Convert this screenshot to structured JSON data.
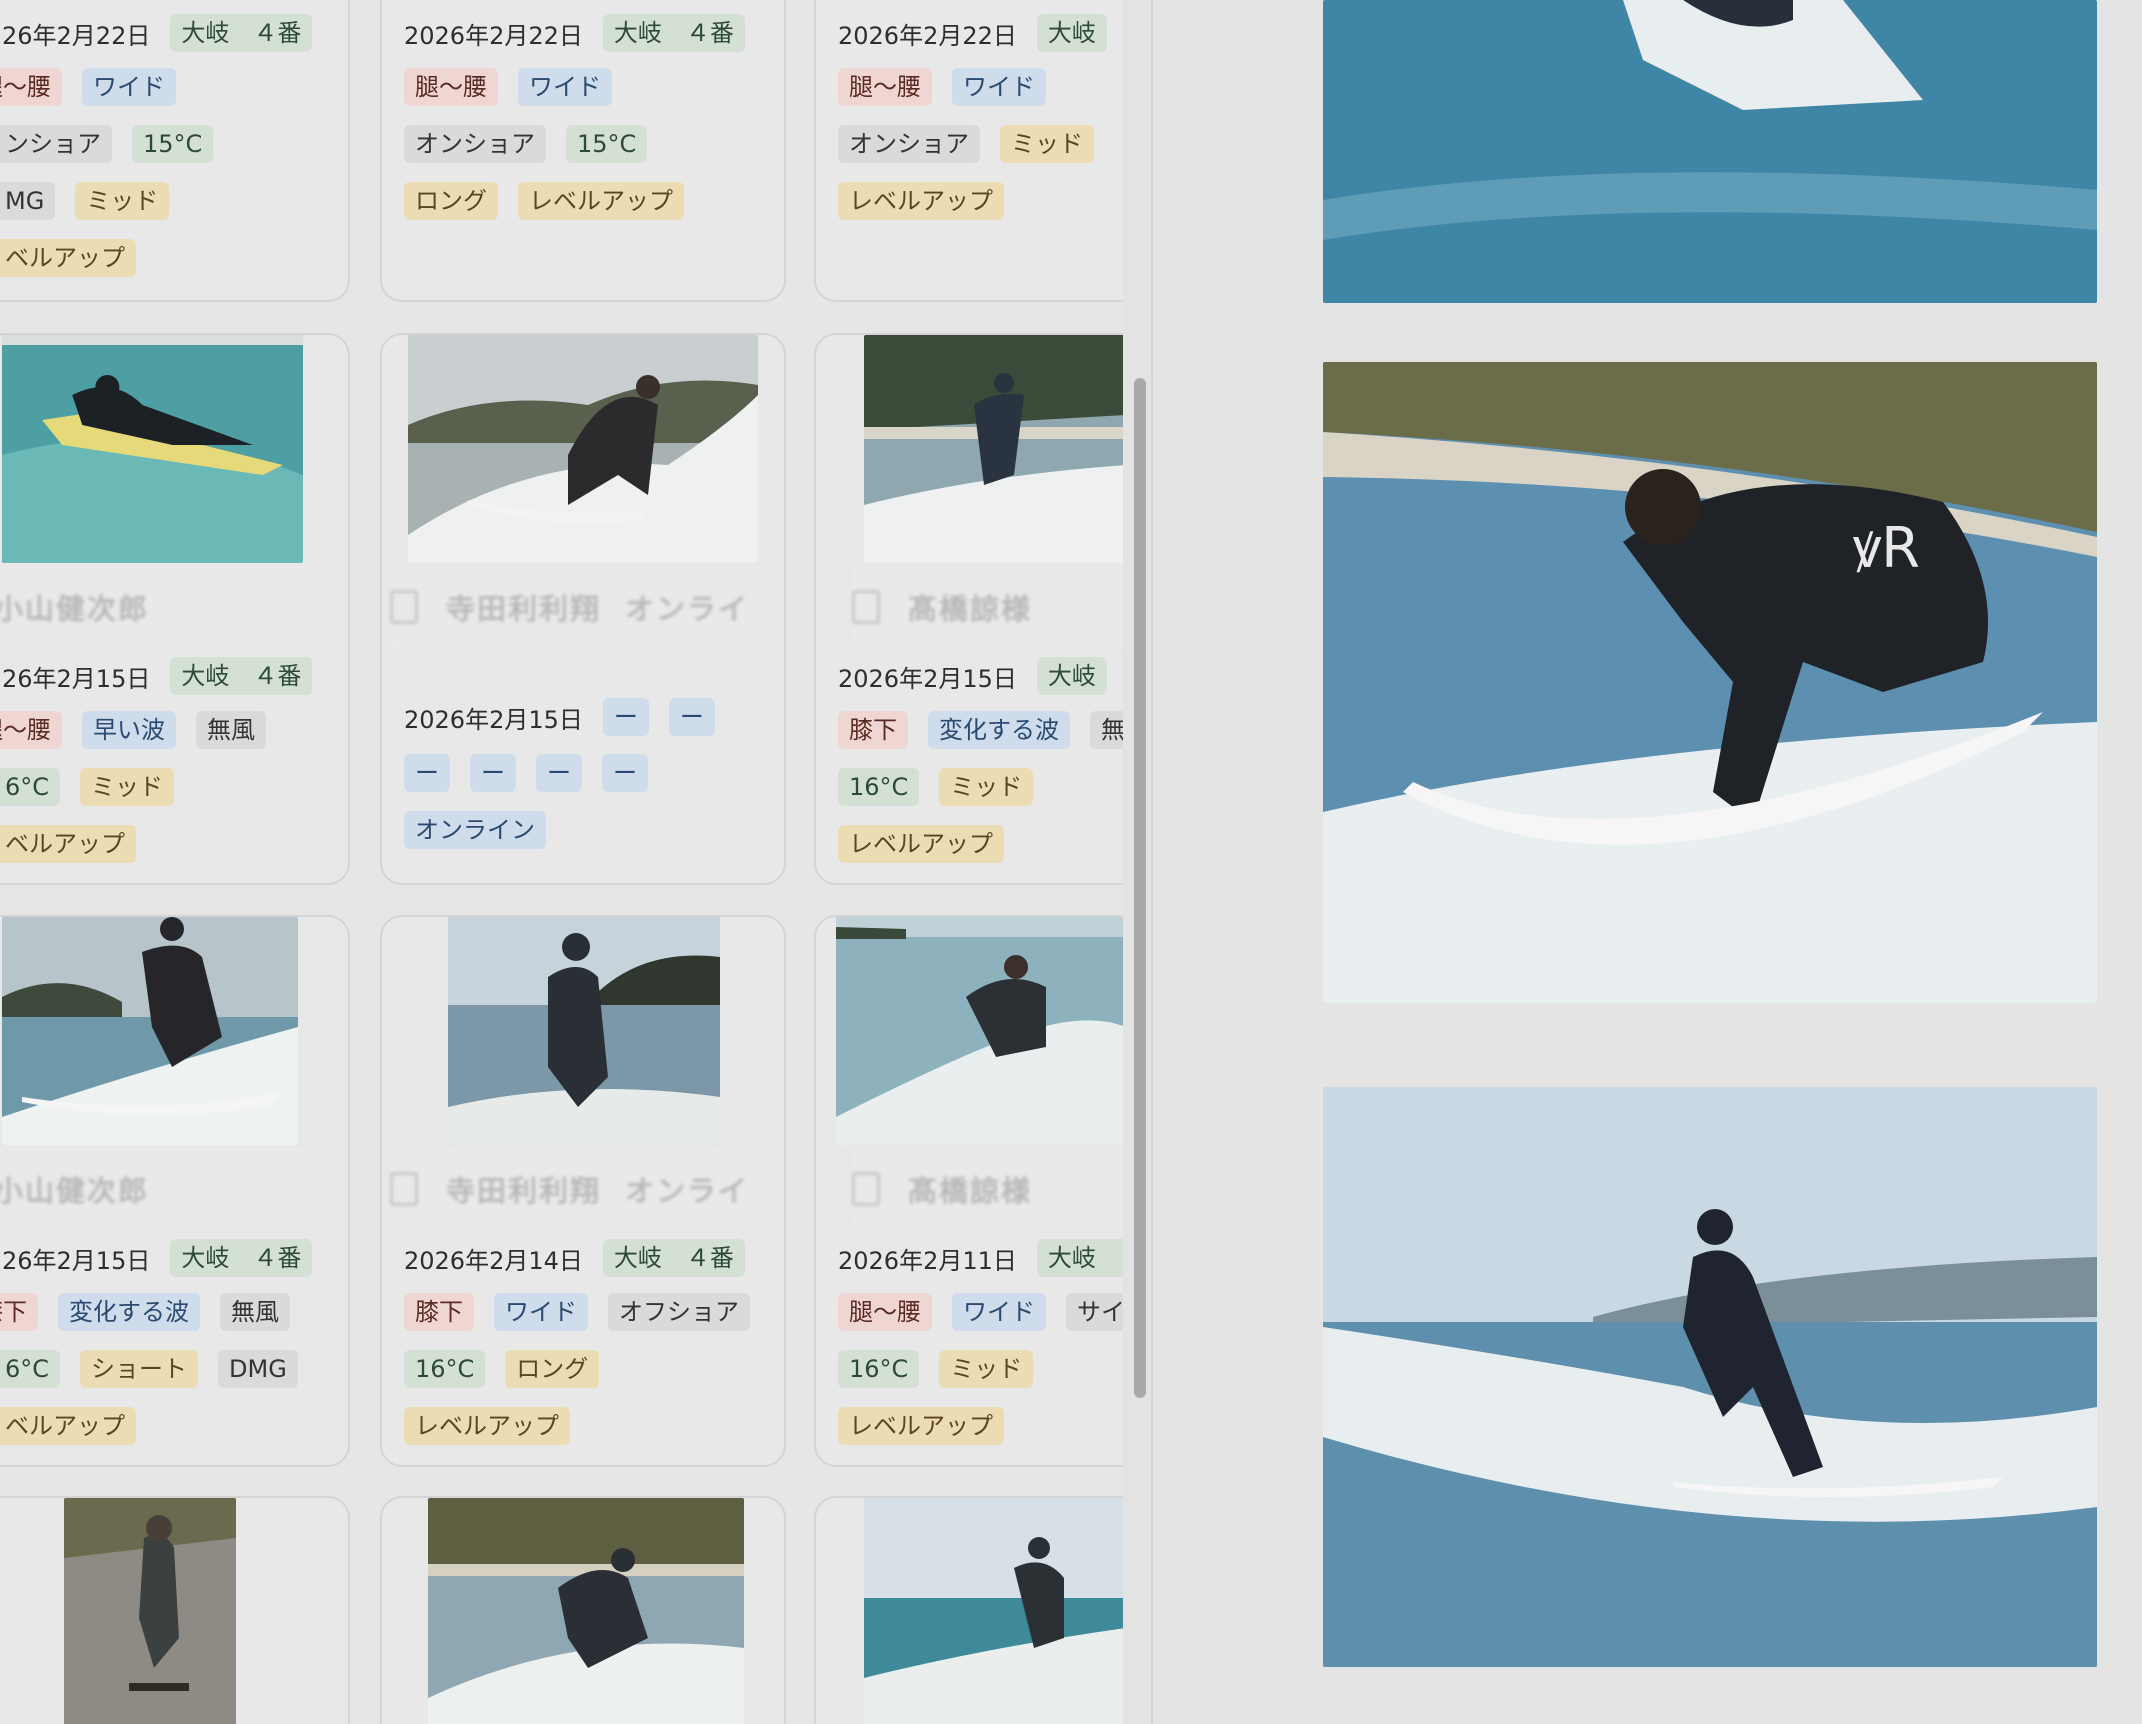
{
  "gallery": {
    "rows": [
      {
        "cards": [
          {
            "date": "26年2月22日",
            "tags": [
              [
                "大岐　４番",
                "green"
              ]
            ],
            "tag_rows": [
              [
                [
                  "腿〜腰",
                  "red"
                ],
                [
                  "ワイド",
                  "blue"
                ]
              ],
              [
                [
                  "ンショア",
                  "gray"
                ],
                [
                  "15°C",
                  "green"
                ]
              ],
              [
                [
                  "MG",
                  "gray"
                ],
                [
                  "ミッド",
                  "yellow"
                ]
              ],
              [
                [
                  "ベルアップ",
                  "yellow"
                ]
              ]
            ]
          },
          {
            "date": "2026年2月22日",
            "tags": [
              [
                "大岐　４番",
                "green"
              ]
            ],
            "tag_rows": [
              [
                [
                  "腿〜腰",
                  "red"
                ],
                [
                  "ワイド",
                  "blue"
                ]
              ],
              [
                [
                  "オンショア",
                  "gray"
                ],
                [
                  "15°C",
                  "green"
                ]
              ],
              [
                [
                  "ロング",
                  "yellow"
                ],
                [
                  "レベルアップ",
                  "yellow"
                ]
              ]
            ]
          },
          {
            "date": "2026年2月22日",
            "tags": [
              [
                "大岐",
                "green"
              ]
            ],
            "tag_rows": [
              [
                [
                  "腿〜腰",
                  "red"
                ],
                [
                  "ワイド",
                  "blue"
                ]
              ],
              [
                [
                  "オンショア",
                  "gray"
                ],
                [
                  "ミッド",
                  "yellow"
                ]
              ],
              [
                [
                  "レベルアップ",
                  "yellow"
                ]
              ]
            ]
          }
        ]
      },
      {
        "cards": [
          {
            "title": "小山健次郎",
            "date": "26年2月15日",
            "tags": [
              [
                "大岐　４番",
                "green"
              ]
            ],
            "tag_rows": [
              [
                [
                  "腿〜腰",
                  "red"
                ],
                [
                  "早い波",
                  "blue"
                ],
                [
                  "無風",
                  "gray"
                ]
              ],
              [
                [
                  "6°C",
                  "green"
                ],
                [
                  "ミッド",
                  "yellow"
                ]
              ],
              [
                [
                  "ベルアップ",
                  "yellow"
                ]
              ]
            ]
          },
          {
            "title": "寺田利利翔",
            "title_extra": "オンライ",
            "date": "2026年2月15日",
            "tags": [
              [
                "ー",
                "blue"
              ],
              [
                "ー",
                "blue"
              ]
            ],
            "tag_rows": [
              [
                [
                  "ー",
                  "blue"
                ],
                [
                  "ー",
                  "blue"
                ],
                [
                  "ー",
                  "blue"
                ],
                [
                  "ー",
                  "blue"
                ]
              ],
              [
                [
                  "オンライン",
                  "blue"
                ]
              ]
            ]
          },
          {
            "title": "髙橋諒様",
            "date": "2026年2月15日",
            "tags": [
              [
                "大岐",
                "green"
              ]
            ],
            "tag_rows": [
              [
                [
                  "膝下",
                  "red"
                ],
                [
                  "変化する波",
                  "blue"
                ],
                [
                  "無",
                  "gray"
                ]
              ],
              [
                [
                  "16°C",
                  "green"
                ],
                [
                  "ミッド",
                  "yellow"
                ]
              ],
              [
                [
                  "レベルアップ",
                  "yellow"
                ]
              ]
            ]
          }
        ]
      },
      {
        "cards": [
          {
            "title": "小山健次郎",
            "date": "26年2月15日",
            "tags": [
              [
                "大岐　４番",
                "green"
              ]
            ],
            "tag_rows": [
              [
                [
                  "膝下",
                  "red"
                ],
                [
                  "変化する波",
                  "blue"
                ],
                [
                  "無風",
                  "gray"
                ]
              ],
              [
                [
                  "6°C",
                  "green"
                ],
                [
                  "ショート",
                  "yellow"
                ],
                [
                  "DMG",
                  "gray"
                ]
              ],
              [
                [
                  "ベルアップ",
                  "yellow"
                ]
              ]
            ]
          },
          {
            "title": "寺田利利翔",
            "title_extra": "オンライ",
            "date": "2026年2月14日",
            "tags": [
              [
                "大岐　４番",
                "green"
              ]
            ],
            "tag_rows": [
              [
                [
                  "膝下",
                  "red"
                ],
                [
                  "ワイド",
                  "blue"
                ],
                [
                  "オフショア",
                  "gray"
                ]
              ],
              [
                [
                  "16°C",
                  "green"
                ],
                [
                  "ロング",
                  "yellow"
                ]
              ],
              [
                [
                  "レベルアップ",
                  "yellow"
                ]
              ]
            ]
          },
          {
            "title": "髙橋諒様",
            "date": "2026年2月11日",
            "tags": [
              [
                "大岐　４",
                "green"
              ]
            ],
            "tag_rows": [
              [
                [
                  "腿〜腰",
                  "red"
                ],
                [
                  "ワイド",
                  "blue"
                ],
                [
                  "サイ",
                  "gray"
                ]
              ],
              [
                [
                  "16°C",
                  "green"
                ],
                [
                  "ミッド",
                  "yellow"
                ]
              ],
              [
                [
                  "レベルアップ",
                  "yellow"
                ]
              ]
            ]
          }
        ]
      }
    ]
  },
  "colors": {
    "red": "#f0d6d2",
    "blue": "#cfdcec",
    "gray": "#dadada",
    "green": "#d4e0d4",
    "yellow": "#ecdcb4"
  }
}
